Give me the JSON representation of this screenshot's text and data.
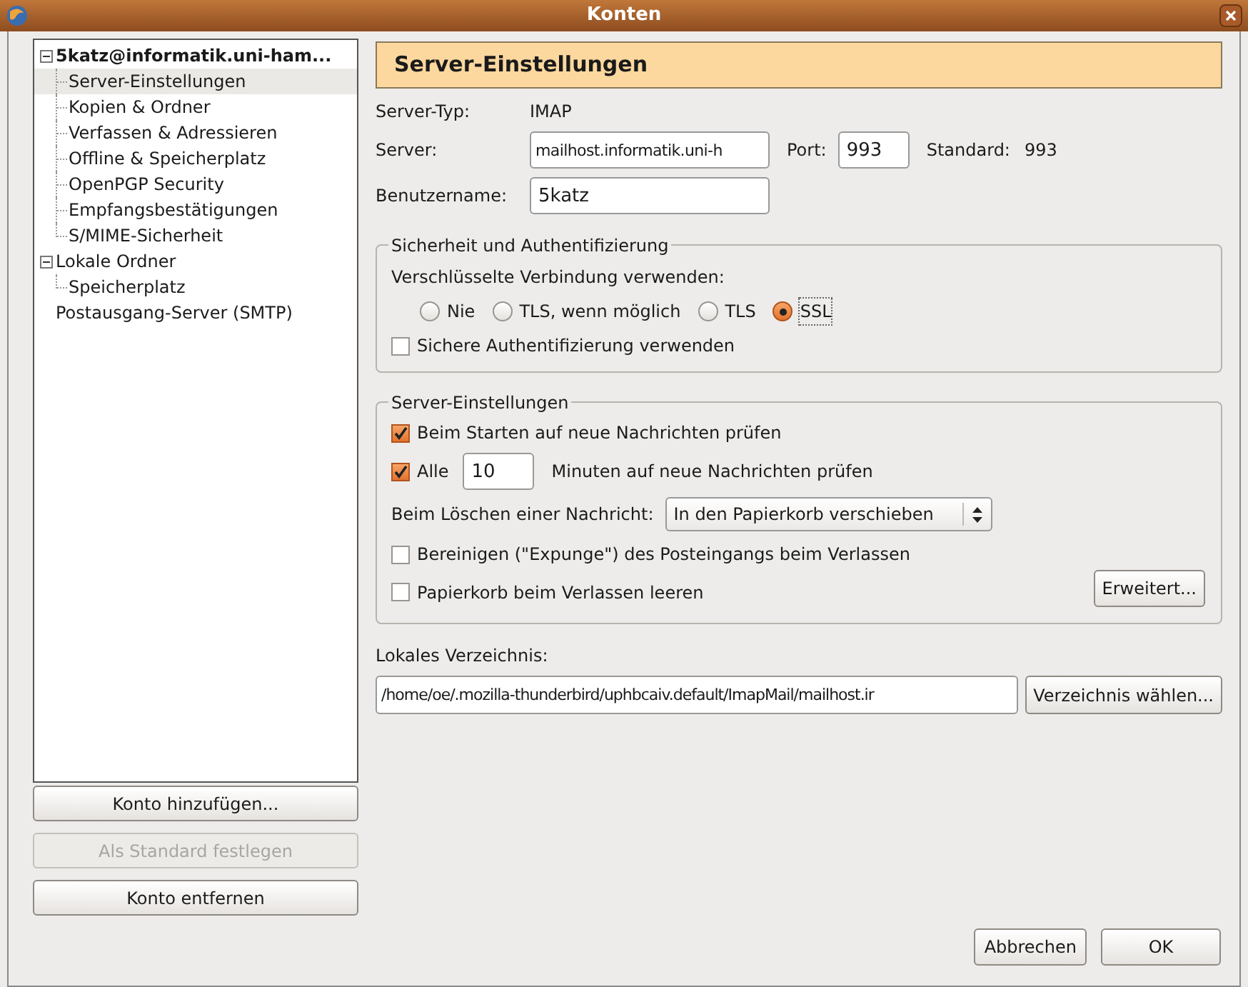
{
  "window": {
    "title": "Konten"
  },
  "tree": [
    {
      "label": "5katz@informatik.uni-ham...",
      "expanded": true,
      "selected": false,
      "children": [
        {
          "label": "Server-Einstellungen",
          "selected": true
        },
        {
          "label": "Kopien & Ordner",
          "selected": false
        },
        {
          "label": "Verfassen & Adressieren",
          "selected": false
        },
        {
          "label": "Offline & Speicherplatz",
          "selected": false
        },
        {
          "label": "OpenPGP Security",
          "selected": false
        },
        {
          "label": "Empfangsbestätigungen",
          "selected": false
        },
        {
          "label": "S/MIME-Sicherheit",
          "selected": false
        }
      ]
    },
    {
      "label": "Lokale Ordner",
      "expanded": true,
      "selected": false,
      "children": [
        {
          "label": "Speicherplatz",
          "selected": false
        }
      ]
    },
    {
      "label": "Postausgang-Server (SMTP)",
      "selected": false
    }
  ],
  "account_buttons": [
    {
      "label": "Konto hinzufügen...",
      "disabled": false
    },
    {
      "label": "Als Standard festlegen",
      "disabled": true
    },
    {
      "label": "Konto entfernen",
      "disabled": false
    }
  ],
  "header": "Server-Einstellungen",
  "server_type": {
    "label": "Server-Typ:",
    "value": "IMAP"
  },
  "server": {
    "label": "Server:",
    "value": "mailhost.informatik.uni-h"
  },
  "port": {
    "label": "Port:",
    "value": "993"
  },
  "default_port": {
    "label": "Standard:",
    "value": "993"
  },
  "username": {
    "label": "Benutzername:",
    "value": "5katz"
  },
  "security": {
    "title": "Sicherheit und Authentifizierung",
    "prompt": "Verschlüsselte Verbindung verwenden:",
    "options": [
      {
        "label": "Nie",
        "selected": false
      },
      {
        "label": "TLS, wenn möglich",
        "selected": false
      },
      {
        "label": "TLS",
        "selected": false
      },
      {
        "label": "SSL",
        "selected": true
      }
    ],
    "secure_auth": {
      "label": "Sichere Authentifizierung verwenden",
      "checked": false
    }
  },
  "server_settings": {
    "title": "Server-Einstellungen",
    "check_on_start": {
      "label": "Beim Starten auf neue Nachrichten prüfen",
      "checked": true
    },
    "check_every": {
      "label": "Alle",
      "checked": true,
      "value": "10",
      "suffix": "Minuten auf neue Nachrichten prüfen"
    },
    "on_delete": {
      "label": "Beim Löschen einer Nachricht:",
      "value": "In den Papierkorb verschieben"
    },
    "expunge": {
      "label": "Bereinigen (\"Expunge\") des Posteingangs beim Verlassen",
      "checked": false
    },
    "empty_trash": {
      "label": "Papierkorb beim Verlassen leeren",
      "checked": false
    },
    "advanced_button": "Erweitert..."
  },
  "local_dir": {
    "label": "Lokales Verzeichnis:",
    "value": "/home/oe/.mozilla-thunderbird/uphbcaiv.default/ImapMail/mailhost.ir",
    "button": "Verzeichnis wählen..."
  },
  "buttons": [
    "Abbrechen",
    "OK"
  ]
}
